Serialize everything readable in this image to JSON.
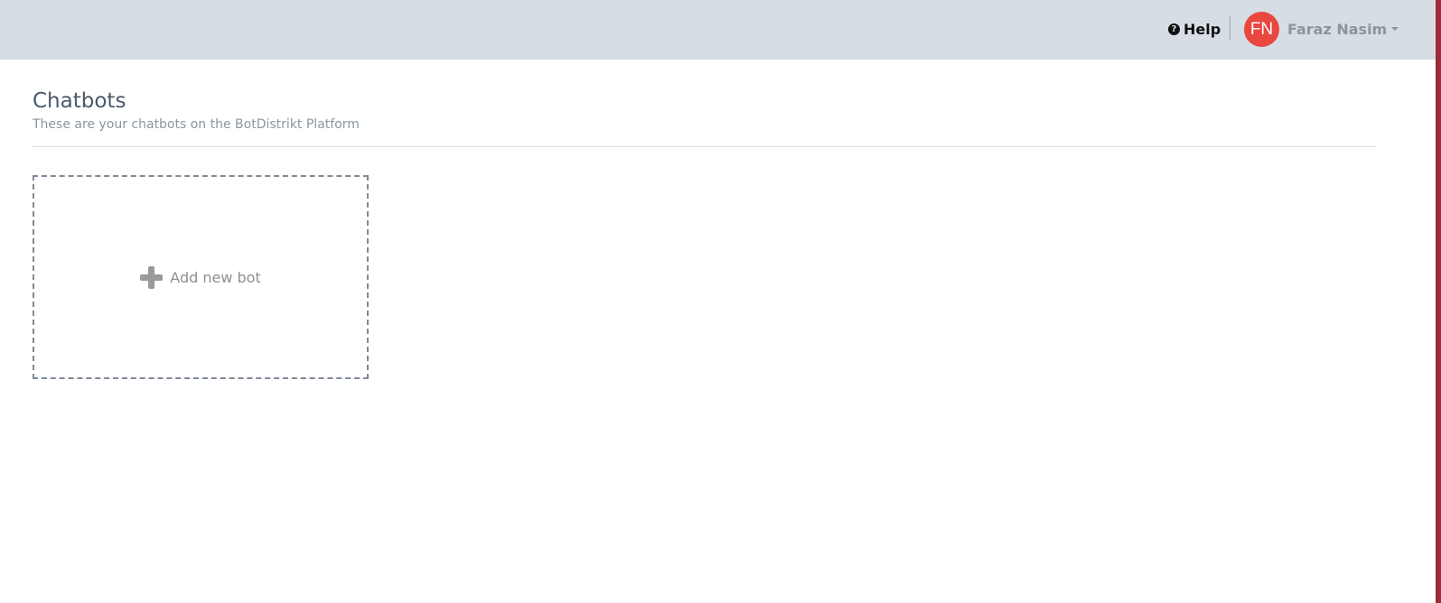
{
  "header": {
    "help_label": "Help",
    "help_icon": "question-circle-icon",
    "user": {
      "initials": "FN",
      "name": "Faraz Nasim",
      "avatar_color": "#e9483f"
    }
  },
  "main": {
    "title": "Chatbots",
    "subtitle": "These are your chatbots on the BotDistrikt Platform",
    "add_bot_label": "Add new bot",
    "add_bot_icon": "plus-icon"
  },
  "colors": {
    "topbar": "#d7dde4",
    "accent_edge": "#9e2a3c"
  }
}
